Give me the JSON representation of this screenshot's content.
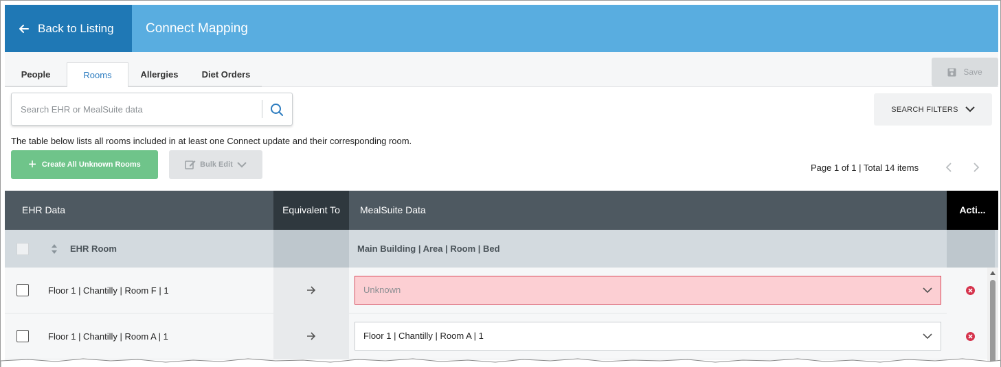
{
  "header": {
    "back_label": "Back to Listing",
    "title": "Connect Mapping"
  },
  "tabs": [
    {
      "label": "People",
      "active": false
    },
    {
      "label": "Rooms",
      "active": true
    },
    {
      "label": "Allergies",
      "active": false
    },
    {
      "label": "Diet Orders",
      "active": false
    }
  ],
  "toolbar": {
    "save_label": "Save",
    "search_placeholder": "Search EHR or MealSuite data",
    "search_filters_label": "SEARCH FILTERS",
    "description": "The table below lists all rooms included in at least one Connect update and their corresponding room.",
    "create_label": "Create All Unknown Rooms",
    "bulk_edit_label": "Bulk Edit",
    "pagination_text": "Page 1 of 1 | Total 14 items"
  },
  "table": {
    "headers": {
      "ehr": "EHR Data",
      "equivalent": "Equivalent To",
      "mealsuite": "MealSuite Data",
      "actions": "Acti..."
    },
    "subheaders": {
      "ehr": "EHR Room",
      "mealsuite": "Main Building | Area | Room | Bed"
    },
    "rows": [
      {
        "ehr": "Floor 1 | Chantilly | Room F | 1",
        "mealsuite": "Unknown",
        "status": "unknown"
      },
      {
        "ehr": "Floor 1 | Chantilly | Room A | 1",
        "mealsuite": "Floor 1 | Chantilly | Room A | 1",
        "status": "mapped"
      }
    ]
  },
  "colors": {
    "header_bg": "#59ade0",
    "back_bg": "#1f78b5",
    "create_green": "#6fc48a",
    "unknown_bg": "#fccfd3",
    "unknown_border": "#d8485a",
    "remove_red": "#d6344d",
    "table_header": "#4e5961"
  }
}
